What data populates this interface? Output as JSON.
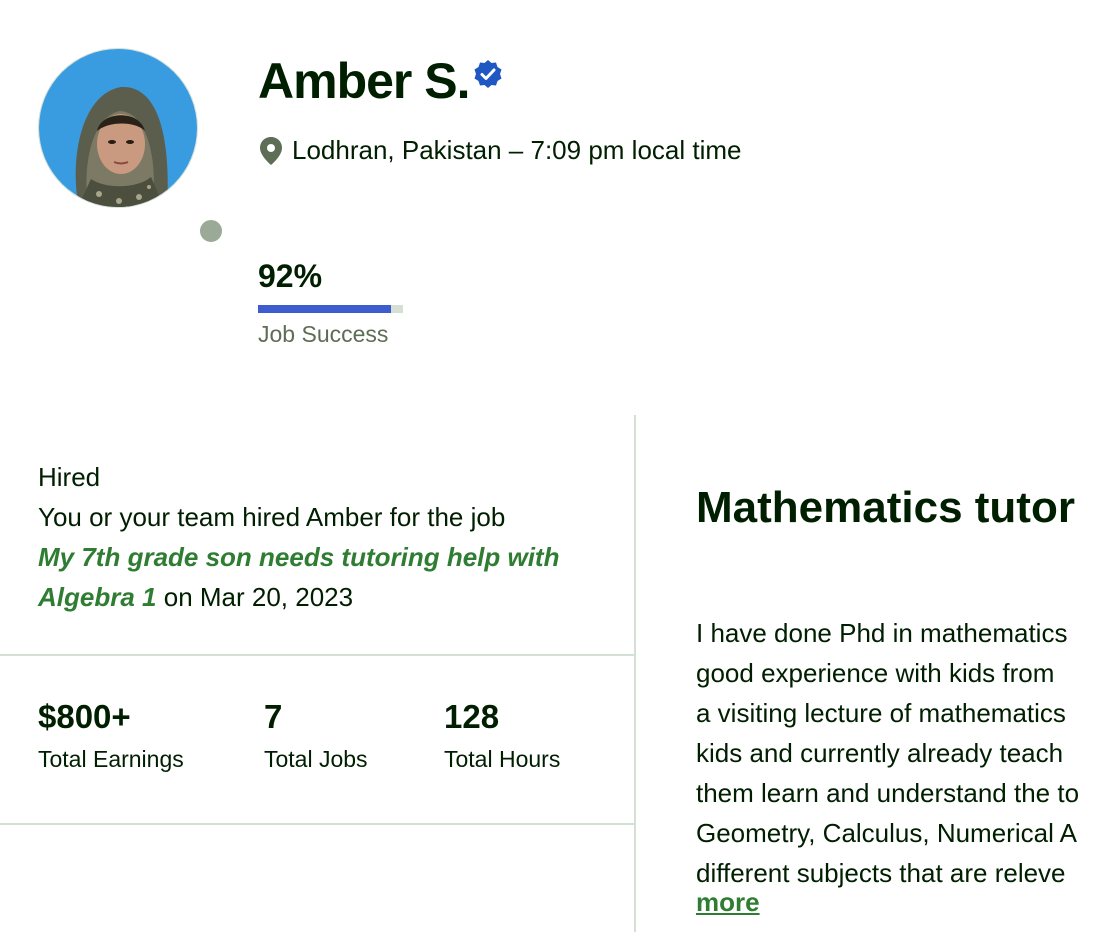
{
  "profile": {
    "name": "Amber S.",
    "location": "Lodhran, Pakistan – 7:09 pm local time",
    "job_success": {
      "value_text": "92%",
      "fraction": 0.92,
      "label": "Job Success"
    }
  },
  "hired": {
    "title": "Hired",
    "description": "You or your team hired Amber for the job",
    "job_title": "My 7th grade son needs tutoring help with Algebra 1",
    "date_text": "on Mar 20, 2023"
  },
  "stats": [
    {
      "value": "$800+",
      "label": "Total Earnings"
    },
    {
      "value": "7",
      "label": "Total Jobs"
    },
    {
      "value": "128",
      "label": "Total Hours"
    }
  ],
  "overview": {
    "title": "Mathematics tutor",
    "bio_lines": [
      "I have done Phd in mathematics",
      "good experience with kids from",
      "a visiting lecture of mathematics",
      "kids and currently already teach",
      "them learn and understand the to",
      "Geometry, Calculus, Numerical A",
      "different subjects that are releve"
    ],
    "more_label": "more"
  },
  "colors": {
    "verified_badge": "#1f57c3",
    "job_success_bar": "#3c5ccf",
    "link_green": "#2e7d32",
    "presence_dot": "#9aaa97"
  },
  "icons": {
    "verified": "verified-badge-icon",
    "location": "map-pin-icon",
    "presence": "status-dot-icon"
  }
}
